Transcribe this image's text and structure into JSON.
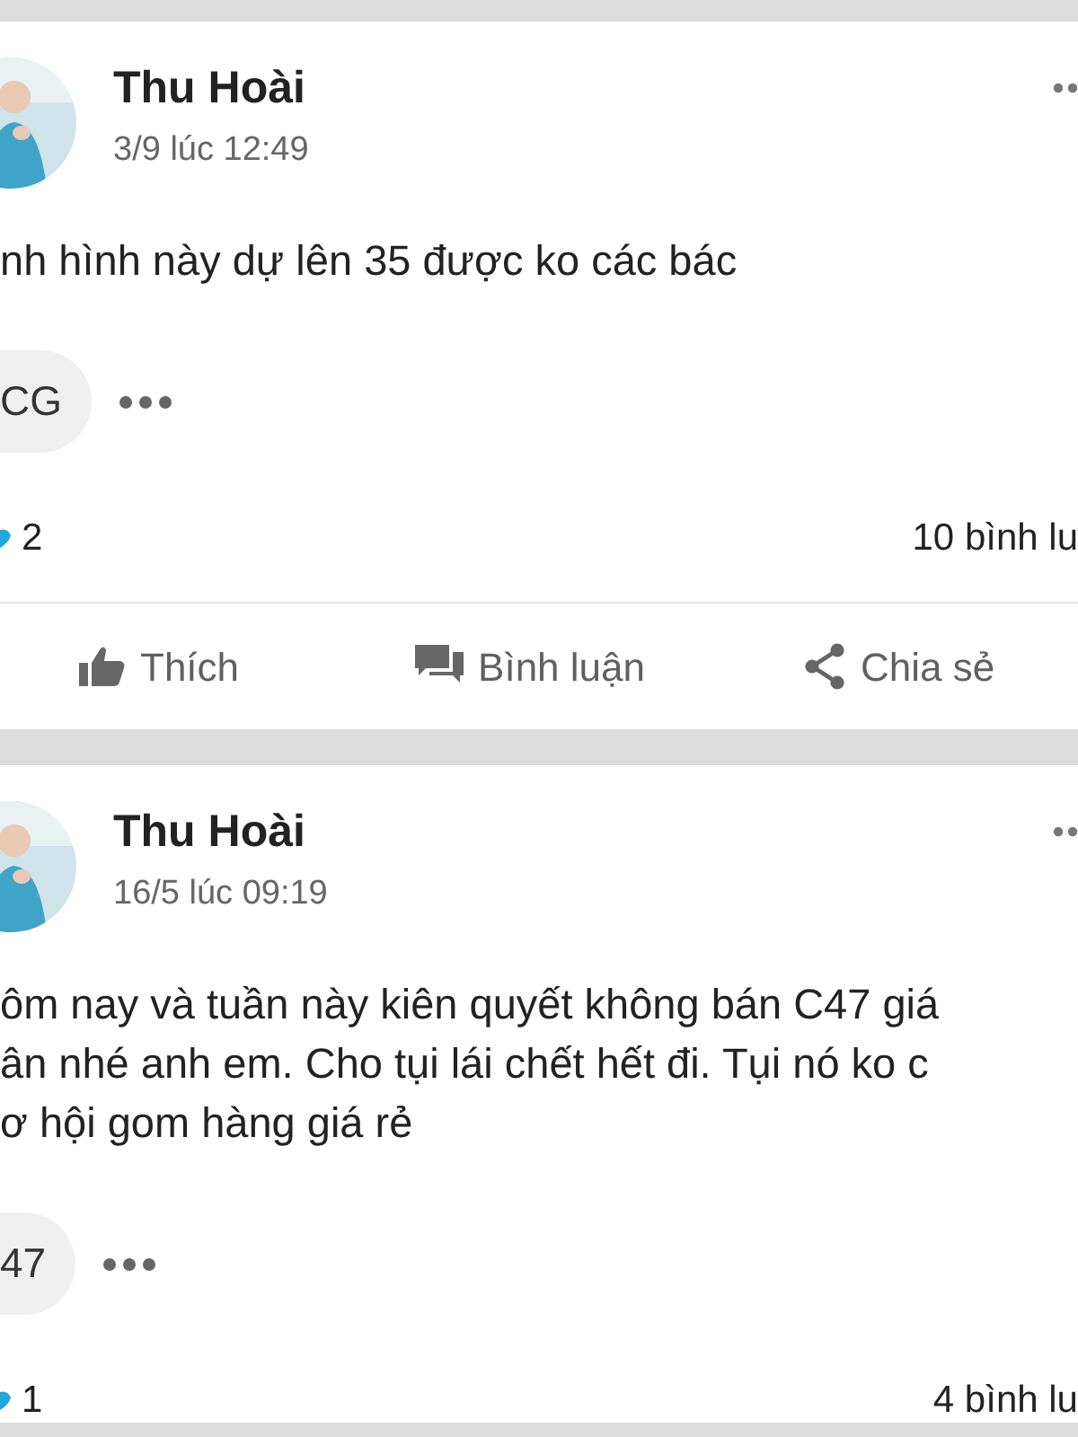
{
  "posts": [
    {
      "author": "Thu Hoài",
      "time": "3/9 lúc 12:49",
      "text_lines": [
        "nh hình này dự lên 35 được ko các bác"
      ],
      "tag": "CG",
      "reaction_count": "2",
      "comment_count": "10 bình lu",
      "actions": [
        {
          "kind": "like",
          "label": "Thích"
        },
        {
          "kind": "comment",
          "label": "Bình luận"
        },
        {
          "kind": "share",
          "label": "Chia sẻ"
        }
      ]
    },
    {
      "author": "Thu Hoài",
      "time": "16/5 lúc 09:19",
      "text_lines": [
        "ôm nay và tuần này kiên quyết không bán C47 giá",
        "ân nhé anh em. Cho tụi lái chết hết đi. Tụi nó ko c",
        "ơ hội gom hàng giá rẻ"
      ],
      "tag": "47",
      "reaction_count": "1",
      "comment_count": "4 bình lu"
    }
  ]
}
